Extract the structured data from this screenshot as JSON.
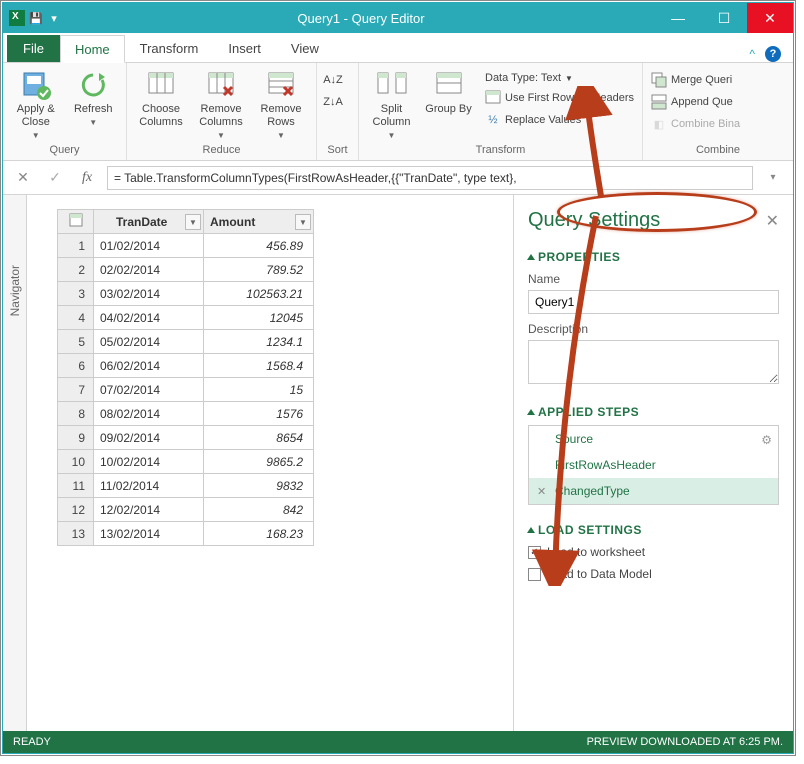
{
  "window": {
    "title": "Query1 - Query Editor"
  },
  "menubar": {
    "file": "File",
    "tabs": [
      "Home",
      "Transform",
      "Insert",
      "View"
    ],
    "active": 0
  },
  "ribbon": {
    "query": {
      "label": "Query",
      "apply_close": "Apply & Close",
      "refresh": "Refresh"
    },
    "reduce": {
      "label": "Reduce",
      "choose_columns": "Choose Columns",
      "remove_columns": "Remove Columns",
      "remove_rows": "Remove Rows"
    },
    "sort": {
      "label": "Sort"
    },
    "transform": {
      "label": "Transform",
      "split_column": "Split Column",
      "group_by": "Group By",
      "data_type": "Data Type: Text",
      "first_row": "Use First Row As Headers",
      "replace": "Replace Values"
    },
    "combine": {
      "label": "Combine",
      "merge": "Merge Queri",
      "append": "Append Que",
      "combine_bin": "Combine Bina"
    }
  },
  "formula": "= Table.TransformColumnTypes(FirstRowAsHeader,{{\"TranDate\", type text},",
  "navigator": {
    "label": "Navigator"
  },
  "grid": {
    "columns": [
      "TranDate",
      "Amount"
    ],
    "rows": [
      {
        "n": 1,
        "date": "01/02/2014",
        "amount": "456.89"
      },
      {
        "n": 2,
        "date": "02/02/2014",
        "amount": "789.52"
      },
      {
        "n": 3,
        "date": "03/02/2014",
        "amount": "102563.21"
      },
      {
        "n": 4,
        "date": "04/02/2014",
        "amount": "12045"
      },
      {
        "n": 5,
        "date": "05/02/2014",
        "amount": "1234.1"
      },
      {
        "n": 6,
        "date": "06/02/2014",
        "amount": "1568.4"
      },
      {
        "n": 7,
        "date": "07/02/2014",
        "amount": "15"
      },
      {
        "n": 8,
        "date": "08/02/2014",
        "amount": "1576"
      },
      {
        "n": 9,
        "date": "09/02/2014",
        "amount": "8654"
      },
      {
        "n": 10,
        "date": "10/02/2014",
        "amount": "9865.2"
      },
      {
        "n": 11,
        "date": "11/02/2014",
        "amount": "9832"
      },
      {
        "n": 12,
        "date": "12/02/2014",
        "amount": "842"
      },
      {
        "n": 13,
        "date": "13/02/2014",
        "amount": "168.23"
      }
    ]
  },
  "settings": {
    "title": "Query Settings",
    "properties": {
      "heading": "PROPERTIES",
      "name_label": "Name",
      "name_value": "Query1",
      "desc_label": "Description",
      "desc_value": ""
    },
    "applied_steps": {
      "heading": "APPLIED STEPS",
      "steps": [
        "Source",
        "FirstRowAsHeader",
        "ChangedType"
      ],
      "active": 2
    },
    "load": {
      "heading": "LOAD SETTINGS",
      "worksheet": "Load to worksheet",
      "worksheet_checked": true,
      "datamodel": "Load to Data Model",
      "datamodel_checked": false
    }
  },
  "statusbar": {
    "left": "READY",
    "right": "PREVIEW DOWNLOADED AT 6:25 PM."
  }
}
